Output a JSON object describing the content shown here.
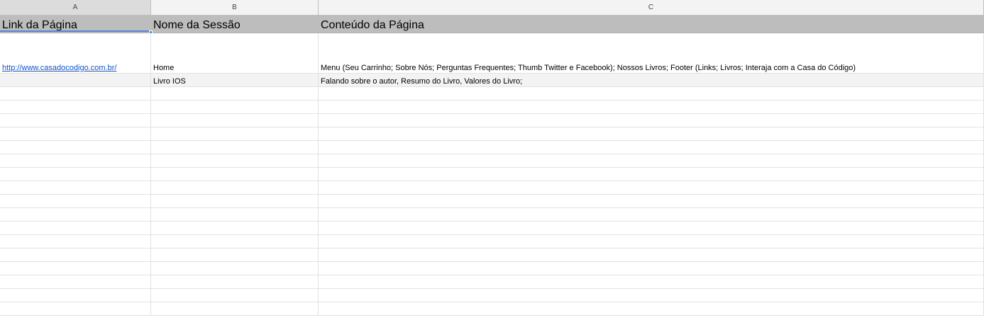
{
  "columns": [
    {
      "letter": "A",
      "selected": true
    },
    {
      "letter": "B",
      "selected": false
    },
    {
      "letter": "C",
      "selected": false
    }
  ],
  "header": {
    "a": "Link da Página",
    "b": "Nome da Sessão",
    "c": "Conteúdo da Página"
  },
  "rows": [
    {
      "a": "http://www.casadocodigo.com.br/",
      "b": "Home",
      "c": "Menu (Seu Carrinho; Sobre Nós; Perguntas Frequentes; Thumb Twitter e Facebook); Nossos Livros; Footer (Links; Livros; Interaja com a Casa do Código)"
    },
    {
      "a": "",
      "b": "Livro IOS",
      "c": "Falando sobre o autor, Resumo do Livro, Valores do Livro;"
    }
  ],
  "colors": {
    "header_fill": "#bdbdbd",
    "link": "#1155cc",
    "selection": "#4a86e8",
    "shaded_row": "#f3f3f3"
  }
}
